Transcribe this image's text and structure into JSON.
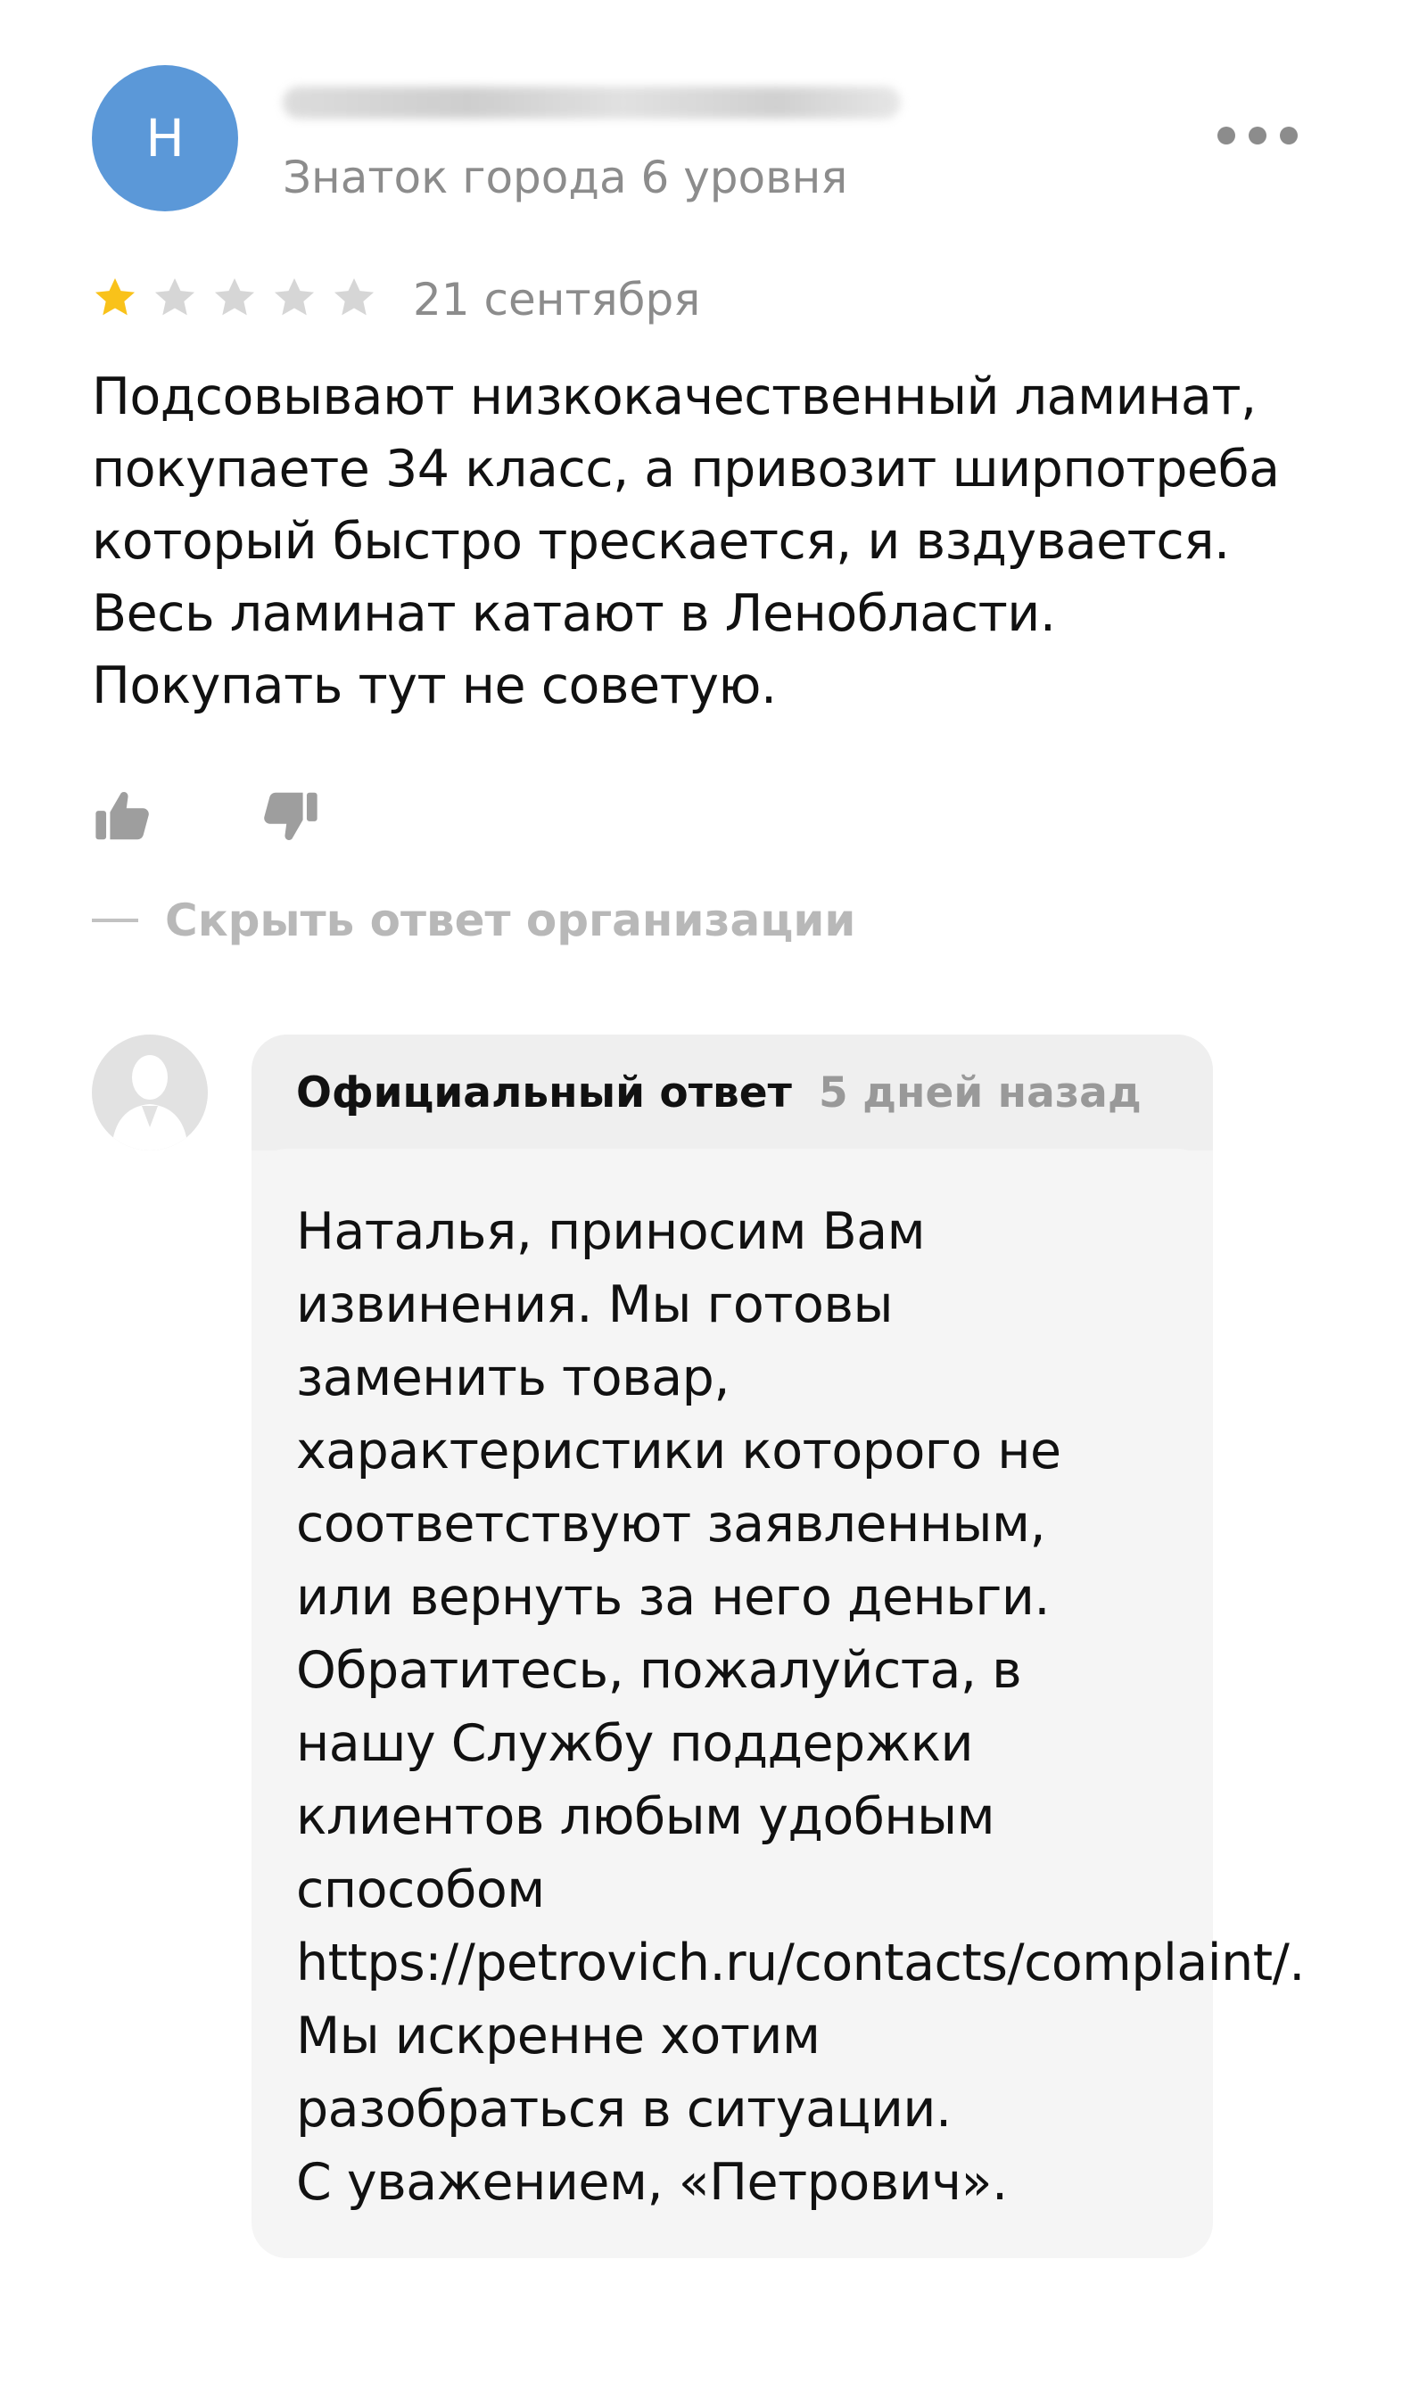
{
  "review": {
    "author_initial": "Н",
    "author_level": "Знаток города 6 уровня",
    "rating": 1,
    "rating_max": 5,
    "date": "21 сентября",
    "text_lines": [
      "Подсовывают низкокачественный ламинат,",
      "покупаете 34 класс, а привозит ширпотреба",
      "который быстро трескается, и вздувается.",
      "Весь ламинат катают в Ленобласти.",
      "Покупать тут не советую."
    ],
    "icons": {
      "more": "more-dots-icon",
      "like": "thumbs-up-icon",
      "dislike": "thumbs-down-icon",
      "star_filled": "star-filled-icon",
      "star_empty": "star-empty-icon"
    }
  },
  "hide_answer_label": "Скрыть ответ организации",
  "answer": {
    "author": "Официальный ответ",
    "date": "5 дней назад",
    "text_lines": [
      "Наталья, приносим Вам",
      "извинения. Мы готовы",
      "заменить товар,",
      "характеристики которого не",
      "соответствуют заявленным,",
      "или вернуть за него деньги.",
      "Обратитесь, пожалуйста, в",
      "нашу Службу поддержки",
      "клиентов любым удобным",
      "способом",
      "https://petrovich.ru/contacts/complaint/.",
      "Мы искренне хотим",
      "разобраться в ситуации.",
      "С уважением, «Петрович»."
    ]
  },
  "colors": {
    "avatar_bg": "#5b98d8",
    "star_filled": "#f9c21a",
    "star_empty": "#d6d6d6",
    "secondary_text": "#8c8c8c",
    "answer_bg": "#f5f5f5"
  }
}
